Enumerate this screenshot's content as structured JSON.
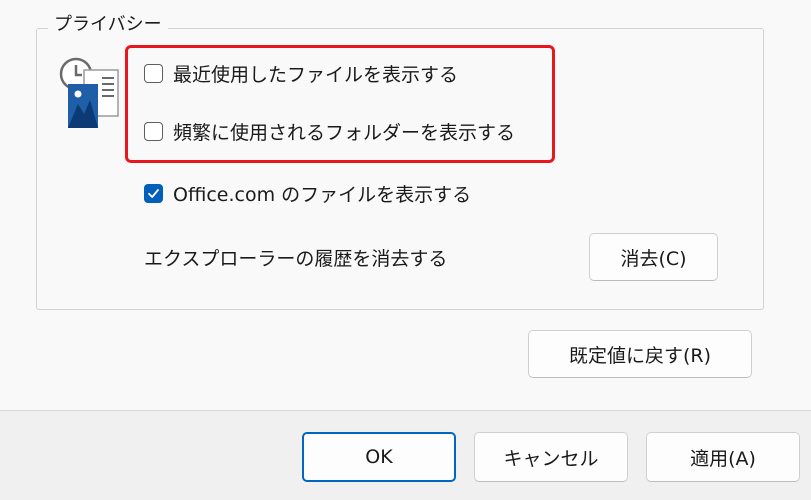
{
  "privacy": {
    "title": "プライバシー",
    "options": [
      {
        "label": "最近使用したファイルを表示する",
        "checked": false
      },
      {
        "label": "頻繁に使用されるフォルダーを表示する",
        "checked": false
      },
      {
        "label": "Office.com のファイルを表示する",
        "checked": true
      }
    ],
    "clear_history_label": "エクスプローラーの履歴を消去する",
    "clear_button": "消去(C)"
  },
  "restore_defaults_button": "既定値に戻す(R)",
  "footer": {
    "ok": "OK",
    "cancel": "キャンセル",
    "apply": "適用(A)"
  },
  "icons": {
    "privacy": "recent-documents-icon",
    "checkmark": "checkmark-icon"
  },
  "colors": {
    "accent": "#005fb8",
    "highlight": "#e8171d"
  }
}
